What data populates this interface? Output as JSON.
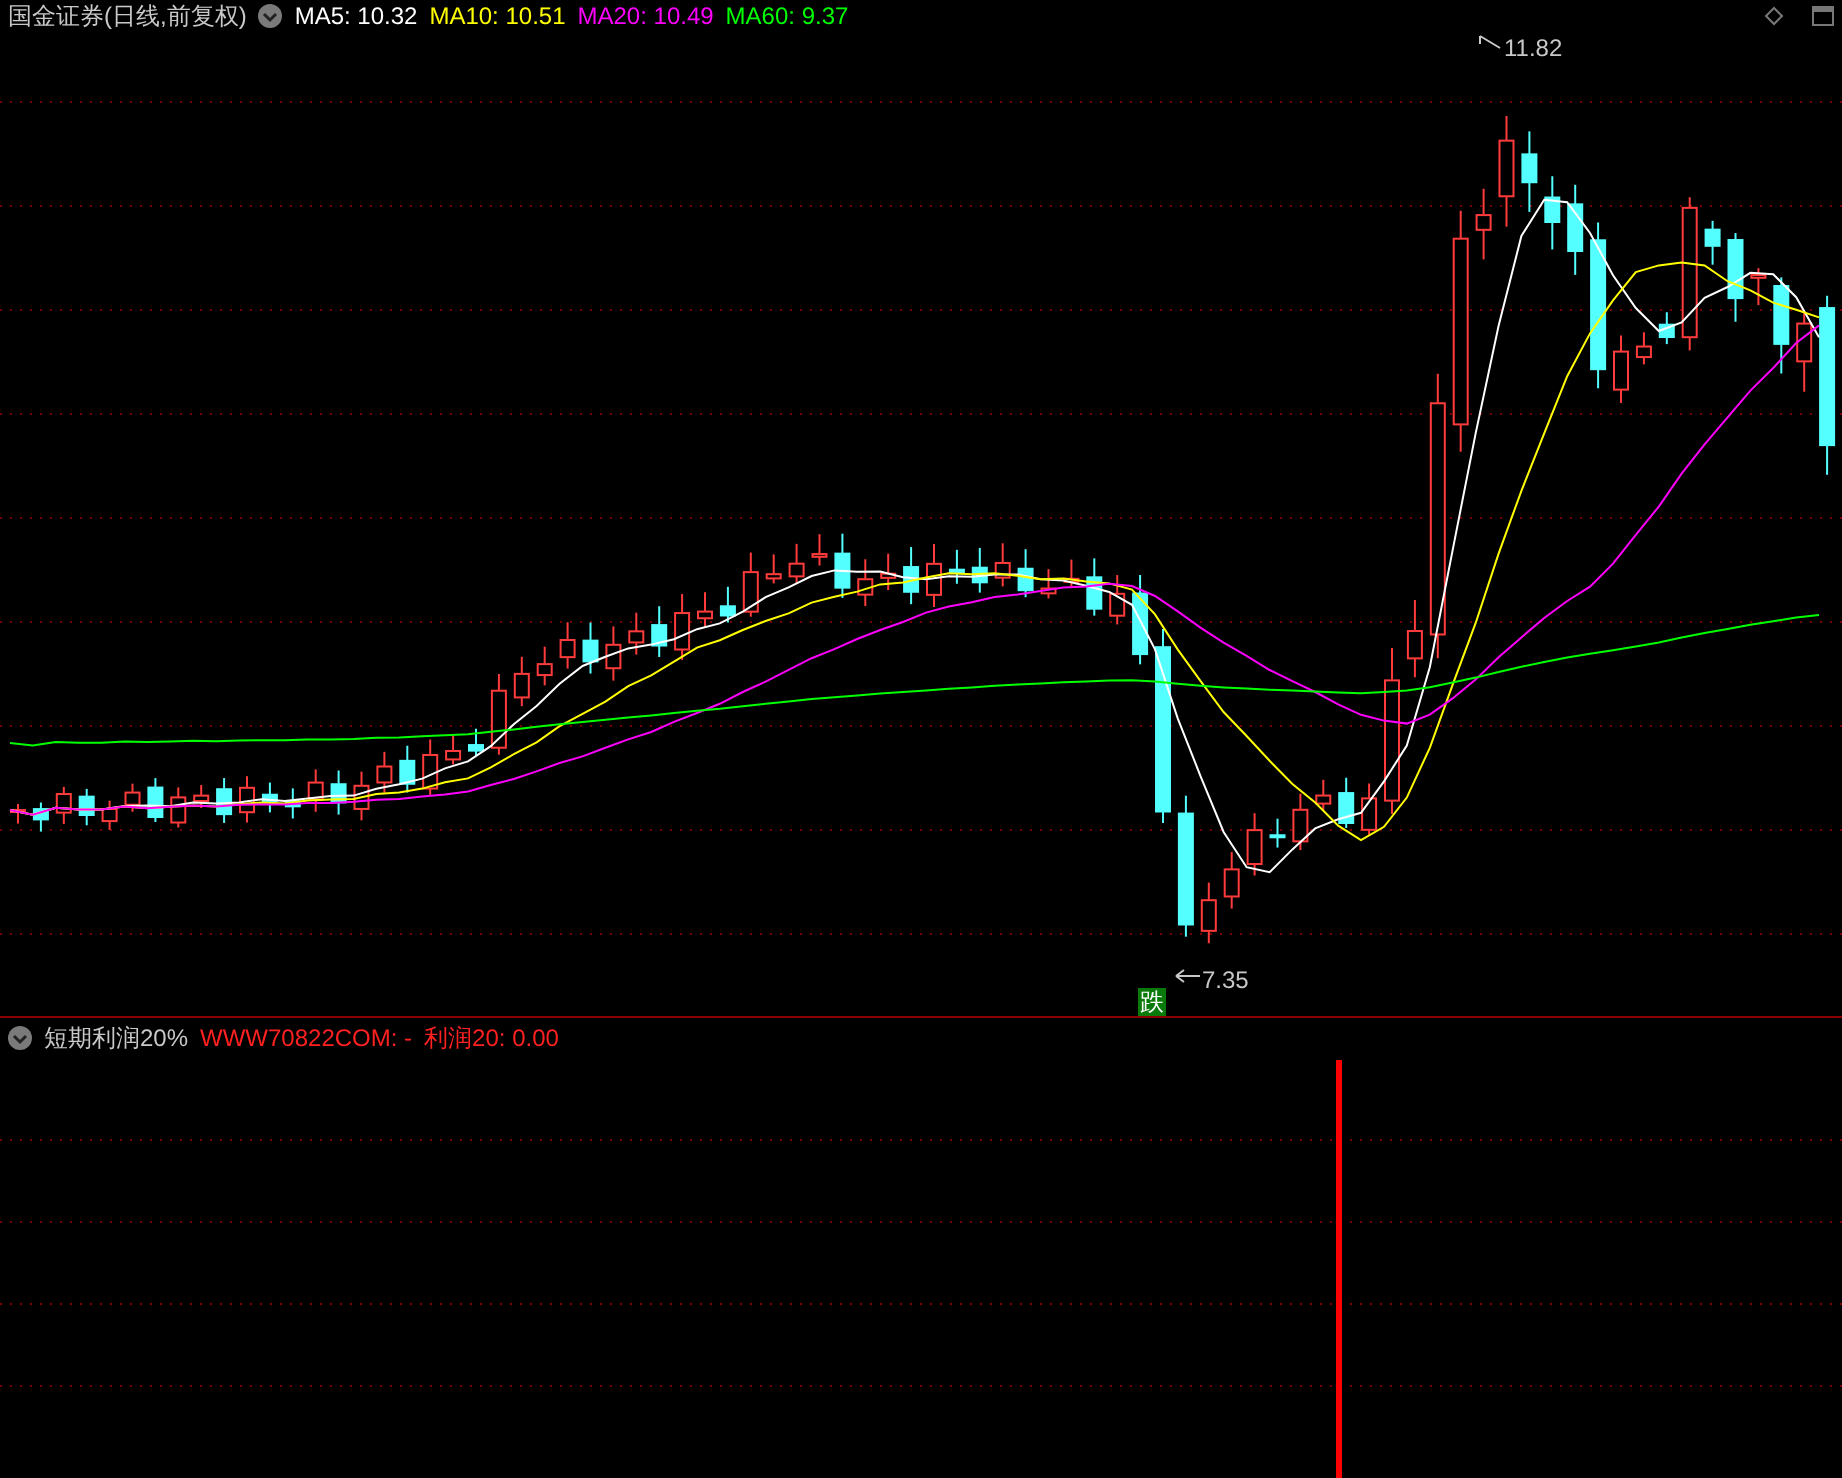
{
  "main_panel": {
    "title": "国金证券(日线,前复权)",
    "indicators": [
      {
        "label": "MA5: 10.32",
        "color": "#ffffff"
      },
      {
        "label": "MA10: 10.51",
        "color": "#ffff00"
      },
      {
        "label": "MA20: 10.49",
        "color": "#ff00ff"
      },
      {
        "label": "MA60: 9.37",
        "color": "#00ff00"
      }
    ],
    "high_label": "11.82",
    "low_label": "7.35",
    "signal": "跌"
  },
  "sub_panel": {
    "title": "短期利润20%",
    "formula": "WWW70822COM: -",
    "value": "利润20: 0.00"
  }
}
